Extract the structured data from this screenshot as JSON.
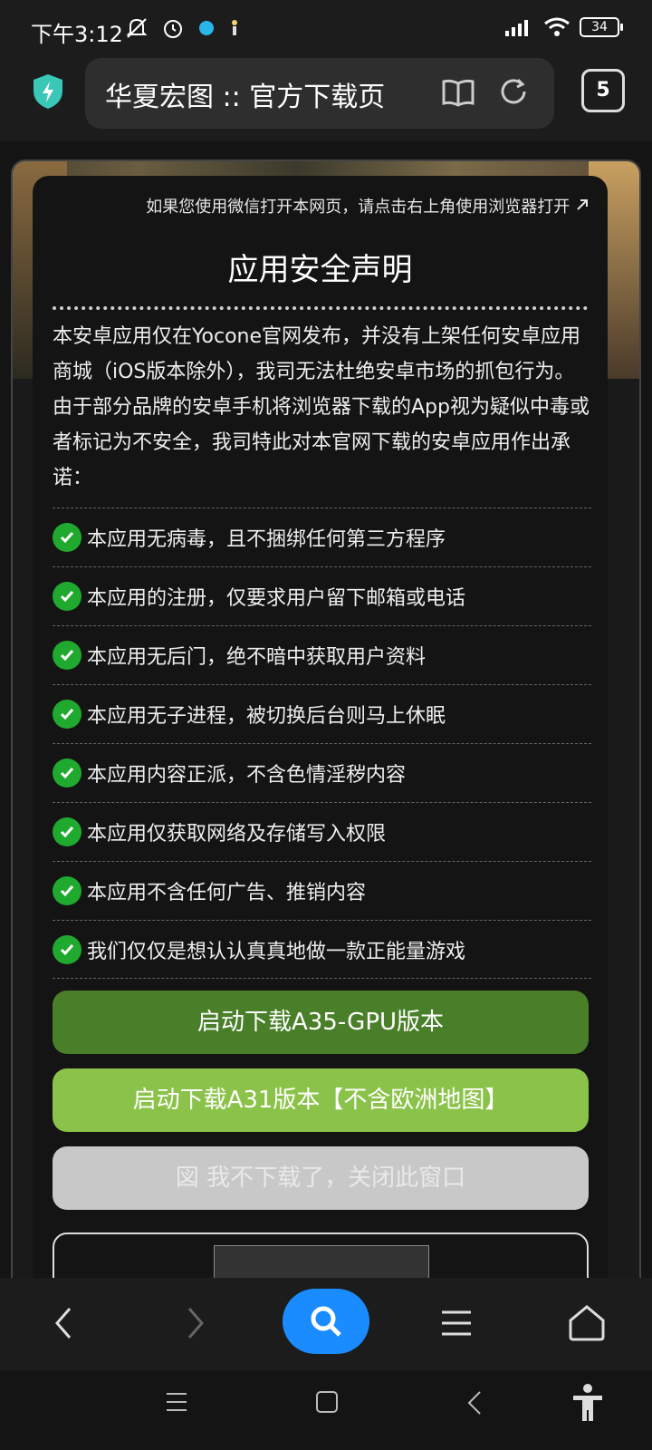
{
  "status": {
    "time": "下午3:12",
    "battery": "34"
  },
  "browser": {
    "url": "华夏宏图 :: 官方下载页",
    "tab_count": "5"
  },
  "modal": {
    "hint": "如果您使用微信打开本网页，请点击右上角使用浏览器打开",
    "title": "应用安全声明",
    "description": "本安卓应用仅在Yocone官网发布，并没有上架任何安卓应用商城（iOS版本除外），我司无法杜绝安卓市场的抓包行为。由于部分品牌的安卓手机将浏览器下载的App视为疑似中毒或者标记为不安全，我司特此对本官网下载的安卓应用作出承诺：",
    "items": [
      "本应用无病毒，且不捆绑任何第三方程序",
      "本应用的注册，仅要求用户留下邮箱或电话",
      "本应用无后门，绝不暗中获取用户资料",
      "本应用无子进程，被切换后台则马上休眠",
      "本应用内容正派，不含色情淫秽内容",
      "本应用仅获取网络及存储写入权限",
      "本应用不含任何广告、推销内容",
      "我们仅仅是想认认真真地做一款正能量游戏"
    ],
    "btn_gpu": "启动下载A35-GPU版本",
    "btn_a31": "启动下载A31版本【不含欧洲地图】",
    "btn_close": "図 我不下载了，关闭此窗口"
  },
  "colors": {
    "accent": "#1a8cff",
    "btn_dark_green": "#4a7f2a",
    "btn_light_green": "#8bc34a",
    "check": "#1faa2f"
  }
}
